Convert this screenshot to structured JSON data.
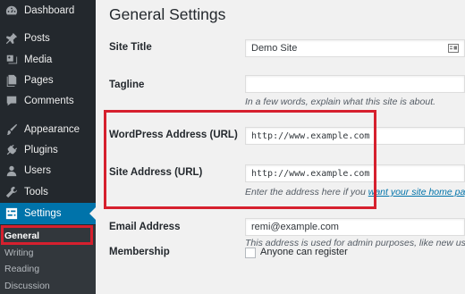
{
  "sidebar": {
    "items": [
      {
        "label": "Dashboard",
        "icon": "dashboard-icon"
      },
      {
        "label": "Posts",
        "icon": "pin-icon"
      },
      {
        "label": "Media",
        "icon": "media-icon"
      },
      {
        "label": "Pages",
        "icon": "pages-icon"
      },
      {
        "label": "Comments",
        "icon": "comment-icon"
      },
      {
        "label": "Appearance",
        "icon": "brush-icon"
      },
      {
        "label": "Plugins",
        "icon": "plug-icon"
      },
      {
        "label": "Users",
        "icon": "user-icon"
      },
      {
        "label": "Tools",
        "icon": "wrench-icon"
      },
      {
        "label": "Settings",
        "icon": "settings-icon"
      }
    ],
    "submenu": [
      {
        "label": "General"
      },
      {
        "label": "Writing"
      },
      {
        "label": "Reading"
      },
      {
        "label": "Discussion"
      }
    ],
    "active": "Settings",
    "current_sub": "General"
  },
  "main": {
    "title": "General Settings",
    "fields": {
      "site_title": {
        "label": "Site Title",
        "value": "Demo Site"
      },
      "tagline": {
        "label": "Tagline",
        "value": "",
        "description": "In a few words, explain what this site is about."
      },
      "wp_address": {
        "label": "WordPress Address (URL)",
        "value": "http://www.example.com"
      },
      "site_address": {
        "label": "Site Address (URL)",
        "value": "http://www.example.com",
        "description_prefix": "Enter the address here if you ",
        "description_link": "want your site home pag"
      },
      "email": {
        "label": "Email Address",
        "value": "remi@example.com",
        "description": "This address is used for admin purposes, like new use"
      },
      "membership": {
        "label": "Membership",
        "checkbox_label": "Anyone can register",
        "checked": false
      }
    }
  },
  "colors": {
    "sidebar_bg": "#23282d",
    "active_bg": "#0073aa",
    "highlight": "#d6202e",
    "link": "#0073aa"
  }
}
